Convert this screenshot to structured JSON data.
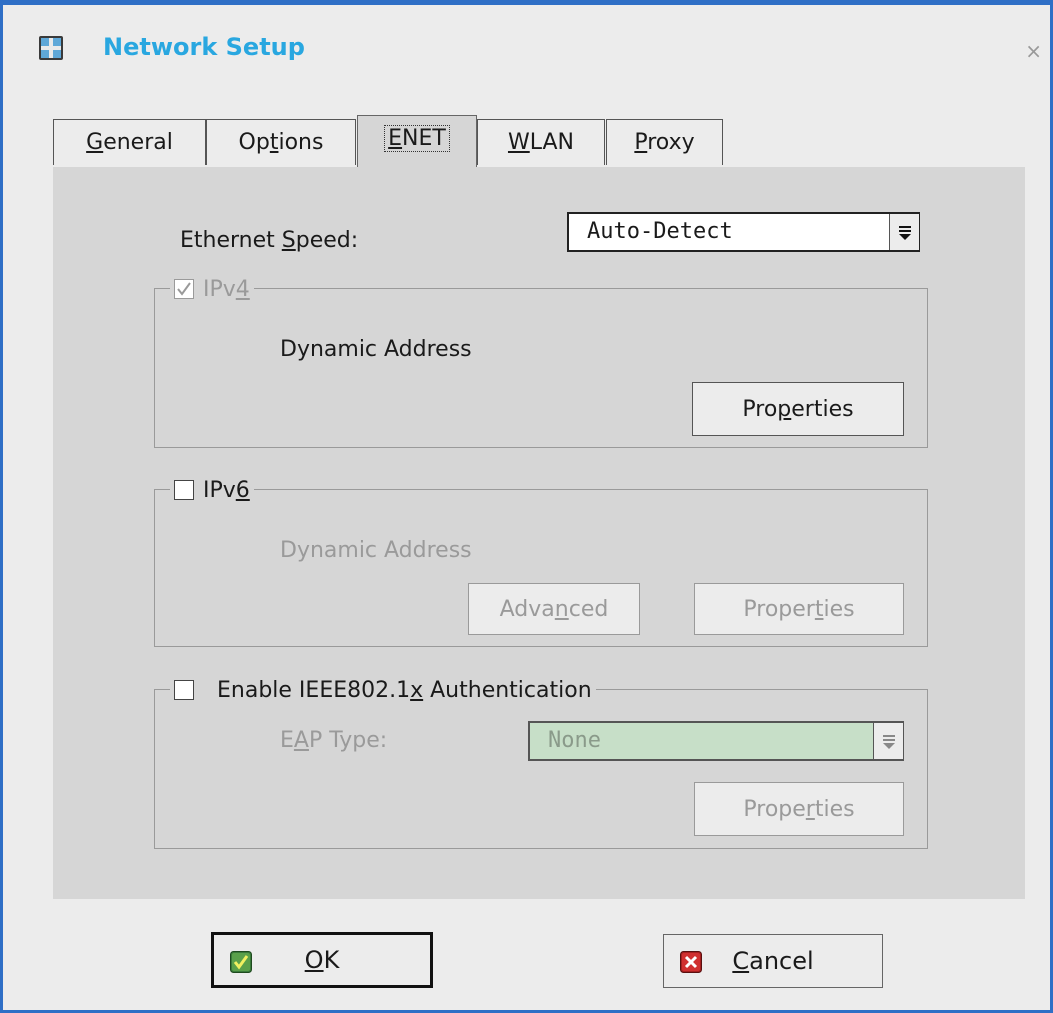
{
  "window": {
    "title": "Network Setup",
    "close_glyph": "×",
    "accent": "#2f6fc6",
    "title_color": "#29a7e0"
  },
  "tabs": [
    {
      "pre": "",
      "u": "G",
      "post": "eneral",
      "active": false
    },
    {
      "pre": "Op",
      "u": "t",
      "post": "ions",
      "active": false
    },
    {
      "pre": "",
      "u": "E",
      "post": "NET",
      "active": true
    },
    {
      "pre": "",
      "u": "W",
      "post": "LAN",
      "active": false
    },
    {
      "pre": "",
      "u": "P",
      "post": "roxy",
      "active": false
    }
  ],
  "enet": {
    "speed_label": {
      "pre": "Ethernet ",
      "u": "S",
      "post": "peed:"
    },
    "speed_value": "Auto-Detect",
    "ipv4": {
      "legend": {
        "pre": "IPv",
        "u": "4",
        "post": ""
      },
      "checked": true,
      "address_text": "Dynamic Address",
      "properties": {
        "pre": "Pro",
        "u": "p",
        "post": "erties"
      }
    },
    "ipv6": {
      "legend": {
        "pre": "IPv",
        "u": "6",
        "post": ""
      },
      "checked": false,
      "address_text": "Dynamic Address",
      "advanced": {
        "pre": "Adva",
        "u": "n",
        "post": "ced"
      },
      "properties": {
        "pre": "Proper",
        "u": "t",
        "post": "ies"
      }
    },
    "auth": {
      "legend": {
        "pre": "Enable IEEE802.1",
        "u": "x",
        "post": " Authentication"
      },
      "checked": false,
      "eap_label": {
        "pre": "E",
        "u": "A",
        "post": "P Type:"
      },
      "eap_value": "None",
      "properties": {
        "pre": "Prope",
        "u": "r",
        "post": "ties"
      }
    }
  },
  "footer": {
    "ok": {
      "pre": "",
      "u": "O",
      "post": "K",
      "icon": "check-icon"
    },
    "cancel": {
      "pre": "",
      "u": "C",
      "post": "ancel",
      "icon": "cross-icon"
    }
  }
}
